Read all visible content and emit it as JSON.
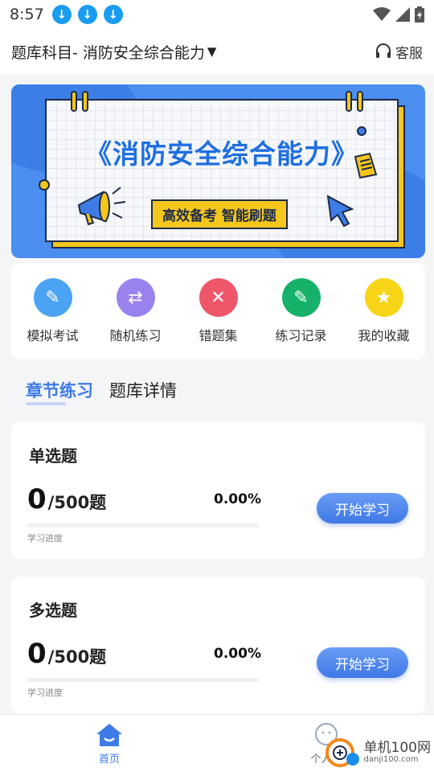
{
  "status_bar": {
    "time": "8:57"
  },
  "header": {
    "title": "题库科目- 消防安全综合能力",
    "service_label": "客服"
  },
  "banner": {
    "title": "《消防安全综合能力》",
    "tagline": "高效备考 智能刷题"
  },
  "quick_actions": [
    {
      "label": "模拟考试",
      "icon": "exam-edit-icon",
      "color": "#4aa3f3"
    },
    {
      "label": "随机练习",
      "icon": "shuffle-icon",
      "color": "#9a82ee"
    },
    {
      "label": "错题集",
      "icon": "wrong-questions-icon",
      "color": "#f0566a"
    },
    {
      "label": "练习记录",
      "icon": "record-icon",
      "color": "#17b26a"
    },
    {
      "label": "我的收藏",
      "icon": "star-icon",
      "color": "#f7d516"
    }
  ],
  "tabs": {
    "active": "章节练习",
    "other": "题库详情"
  },
  "question_cards": [
    {
      "title": "单选题",
      "done": "0",
      "total": "/500题",
      "percent": "0.00%",
      "progress": 0,
      "progress_label": "学习进度",
      "button": "开始学习"
    },
    {
      "title": "多选题",
      "done": "0",
      "total": "/500题",
      "percent": "0.00%",
      "progress": 0,
      "progress_label": "学习进度",
      "button": "开始学习"
    }
  ],
  "bottom_nav": {
    "home_label": "首页",
    "profile_label": "个人中",
    "active_color": "#3f7be6"
  },
  "watermark": {
    "name": "单机100网",
    "url": "danji100.com"
  }
}
